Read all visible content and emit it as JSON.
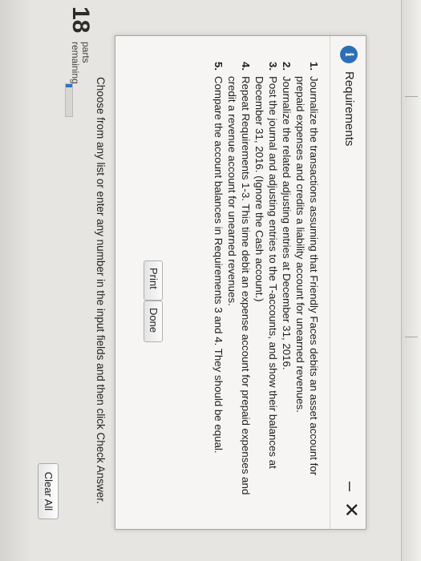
{
  "dialog": {
    "icon": "info-icon",
    "icon_glyph": "i",
    "title": "Requirements",
    "minimize_glyph": "–",
    "close_glyph": "✕",
    "requirements": [
      {
        "num": "1.",
        "text": "Journalize the transactions assuming that Friendly Faces debits an asset account for prepaid expenses and credits a liability account for unearned revenues."
      },
      {
        "num": "2.",
        "text": "Journalize the related adjusting entries at December 31, 2016."
      },
      {
        "num": "3.",
        "text": "Post the journal and adjusting entries to the T-accounts, and show their balances at December 31, 2016. (Ignore the Cash account.)"
      },
      {
        "num": "4.",
        "text": "Repeat Requirements 1-3. This time debit an expense account for prepaid expenses and credit a revenue account for unearned revenues."
      },
      {
        "num": "5.",
        "text": "Compare the account balances in Requirements 3 and 4. They should be equal."
      }
    ],
    "print_label": "Print",
    "done_label": "Done"
  },
  "instructions": "Choose from any list or enter any number in the input fields and then click Check Answer.",
  "parts": {
    "count": "18",
    "label_line1": "parts",
    "label_line2": "remaining",
    "progress_fraction": 0.1
  },
  "clear_all_label": "Clear All",
  "colors": {
    "accent": "#2f73c6",
    "info_icon": "#2c6fb7"
  }
}
